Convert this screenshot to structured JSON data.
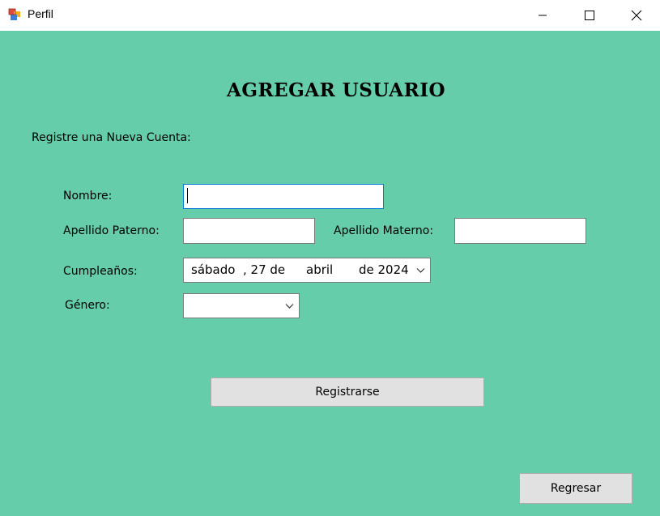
{
  "window": {
    "title": "Perfil",
    "icon": "winforms-app-icon"
  },
  "form": {
    "heading": "AGREGAR USUARIO",
    "subtitle": "Registre una Nueva Cuenta:",
    "nombre_label": "Nombre:",
    "nombre_value": "",
    "apellido_paterno_label": "Apellido Paterno:",
    "apellido_paterno_value": "",
    "apellido_materno_label": "Apellido Materno:",
    "apellido_materno_value": "",
    "cumpleanos_label": "Cumpleaños:",
    "date": {
      "weekday": "sábado",
      "day": ", 27 de",
      "month": "abril",
      "year": "de 2024"
    },
    "genero_label": "Género:",
    "genero_value": "",
    "register_button": "Registrarse",
    "back_button": "Regresar"
  },
  "colors": {
    "background": "#66cdaa",
    "button": "#e1e1e1",
    "focus_border": "#0078d7"
  }
}
